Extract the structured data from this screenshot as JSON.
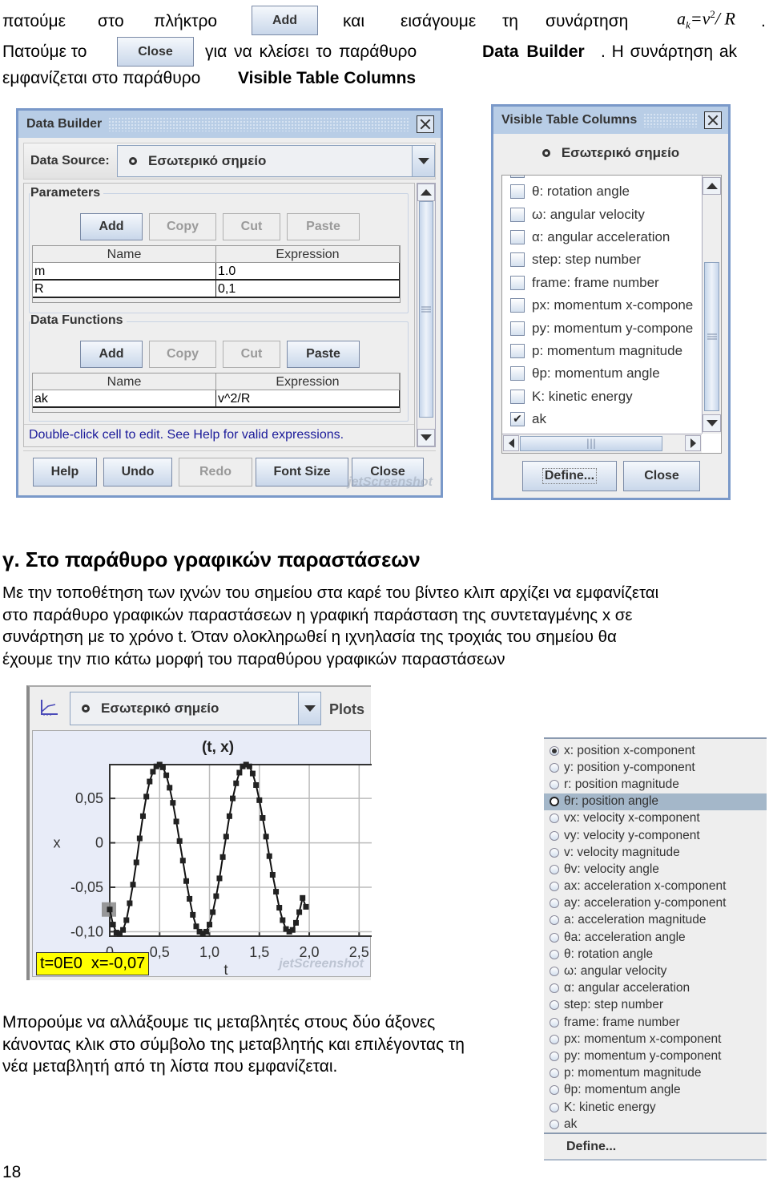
{
  "intro": {
    "line1_words": [
      "πατούμε",
      "στο",
      "πλήκτρο",
      "και",
      "εισάγουμε",
      "τη",
      "συνάρτηση"
    ],
    "inline_add_button": "Add",
    "formula": {
      "a": "a",
      "sub": "k",
      "eq": "=v",
      "sup": "2",
      "rest": "/ R",
      "end": "."
    },
    "line2_prefix": "Πατούμε το",
    "inline_close_button": "Close",
    "line2_mid": "για να κλείσει το παράθυρο",
    "line2_bold": "Data Builder",
    "line2_suffix": ". Η συνάρτηση ak",
    "line3_prefix": "εμφανίζεται στο παράθυρο",
    "line3_bold": "Visible Table Columns"
  },
  "data_builder": {
    "title": "Data Builder",
    "data_source_label": "Data Source:",
    "data_source_value": "Εσωτερικό σημείο",
    "parameters": {
      "label": "Parameters",
      "buttons": [
        {
          "label": "Add",
          "enabled": true
        },
        {
          "label": "Copy",
          "enabled": false
        },
        {
          "label": "Cut",
          "enabled": false
        },
        {
          "label": "Paste",
          "enabled": false
        }
      ],
      "columns": [
        "Name",
        "Expression"
      ],
      "rows": [
        [
          "m",
          "1.0"
        ],
        [
          "R",
          "0,1"
        ]
      ]
    },
    "functions": {
      "label": "Data Functions",
      "buttons": [
        {
          "label": "Add",
          "enabled": true
        },
        {
          "label": "Copy",
          "enabled": false
        },
        {
          "label": "Cut",
          "enabled": false
        },
        {
          "label": "Paste",
          "enabled": true
        }
      ],
      "columns": [
        "Name",
        "Expression"
      ],
      "rows": [
        [
          "ak",
          "v^2/R"
        ]
      ]
    },
    "hint": "Double-click cell to edit. See Help for valid expressions.",
    "footer_buttons": [
      {
        "label": "Help",
        "enabled": true
      },
      {
        "label": "Undo",
        "enabled": true
      },
      {
        "label": "Redo",
        "enabled": false
      },
      {
        "label": "Font Size",
        "enabled": true
      },
      {
        "label": "Close",
        "enabled": true
      }
    ],
    "watermark": "jetScreenshot"
  },
  "visible_columns": {
    "title": "Visible Table Columns",
    "source": "Εσωτερικό σημείο",
    "items": [
      {
        "label": "θ: rotation angle",
        "checked": false
      },
      {
        "label": "ω: angular velocity",
        "checked": false
      },
      {
        "label": "α: angular acceleration",
        "checked": false
      },
      {
        "label": "step: step number",
        "checked": false
      },
      {
        "label": "frame: frame number",
        "checked": false
      },
      {
        "label": "px: momentum x-compone",
        "checked": false
      },
      {
        "label": "py: momentum y-compone",
        "checked": false
      },
      {
        "label": "p: momentum magnitude",
        "checked": false
      },
      {
        "label": "θp: momentum angle",
        "checked": false
      },
      {
        "label": "K: kinetic energy",
        "checked": false
      },
      {
        "label": "ak",
        "checked": true
      }
    ],
    "check_mark": "✔",
    "define_button": "Define...",
    "close_button": "Close"
  },
  "section": {
    "heading": "γ. Στο παράθυρο γραφικών παραστάσεων",
    "paragraph_lines": [
      "Με την τοποθέτηση των ιχνών του σημείου στα καρέ του βίντεο κλιπ αρχίζει να εμφανίζεται",
      "στο παράθυρο γραφικών παραστάσεων η γραφική παράσταση της συντεταγμένης x σε",
      "συνάρτηση με το χρόνο t. Όταν ολοκληρωθεί η ιχνηλασία της τροχιάς του σημείου θα",
      "έχουμε την πιο κάτω μορφή του παραθύρου γραφικών παραστάσεων"
    ]
  },
  "plot_panel": {
    "source": "Εσωτερικό σημείο",
    "plots_label": "Plots",
    "readout": "t=0E0  x=-0,07",
    "watermark": "jetScreenshot"
  },
  "chart_data": {
    "type": "scatter",
    "title": "(t, x)",
    "xlabel": "t",
    "ylabel": "x",
    "xlim": [
      0,
      2.65
    ],
    "ylim": [
      -0.105,
      0.088
    ],
    "xticks": [
      0,
      0.5,
      1.0,
      1.5,
      2.0,
      2.5
    ],
    "xtick_labels": [
      "0",
      "0,5",
      "1,0",
      "1,5",
      "2,0",
      "2,5"
    ],
    "yticks": [
      -0.1,
      -0.05,
      0,
      0.05
    ],
    "ytick_labels": [
      "-0,10",
      "-0,05",
      "0",
      "0,05"
    ],
    "grid": true,
    "connected_line": true,
    "highlighted_point": [
      0,
      -0.075
    ],
    "series": [
      {
        "name": "x",
        "x": [
          0,
          0.033,
          0.067,
          0.1,
          0.133,
          0.167,
          0.2,
          0.233,
          0.267,
          0.3,
          0.333,
          0.367,
          0.4,
          0.433,
          0.467,
          0.5,
          0.533,
          0.567,
          0.6,
          0.633,
          0.667,
          0.7,
          0.733,
          0.767,
          0.8,
          0.833,
          0.867,
          0.9,
          0.933,
          0.967,
          1.0,
          1.033,
          1.067,
          1.1,
          1.133,
          1.167,
          1.2,
          1.233,
          1.267,
          1.3,
          1.333,
          1.367,
          1.4,
          1.433,
          1.467,
          1.5,
          1.533,
          1.567,
          1.6,
          1.633,
          1.667,
          1.7,
          1.733,
          1.767,
          1.8,
          1.833,
          1.867,
          1.9,
          1.933,
          1.967
        ],
        "y": [
          -0.075,
          -0.092,
          -0.101,
          -0.102,
          -0.098,
          -0.087,
          -0.068,
          -0.047,
          -0.022,
          0.005,
          0.03,
          0.052,
          0.069,
          0.08,
          0.086,
          0.088,
          0.085,
          0.076,
          0.062,
          0.045,
          0.024,
          0.002,
          -0.02,
          -0.043,
          -0.063,
          -0.081,
          -0.094,
          -0.1,
          -0.102,
          -0.1,
          -0.092,
          -0.078,
          -0.06,
          -0.04,
          -0.016,
          0.007,
          0.03,
          0.05,
          0.067,
          0.079,
          0.086,
          0.088,
          0.086,
          0.078,
          0.065,
          0.048,
          0.028,
          0.007,
          -0.015,
          -0.036,
          -0.055,
          -0.073,
          -0.087,
          -0.097,
          -0.1,
          -0.098,
          -0.09,
          -0.078,
          -0.062,
          -0.072
        ]
      }
    ]
  },
  "variable_menu": {
    "items": [
      {
        "label": "x: position x-component",
        "selected": true,
        "highlighted": false
      },
      {
        "label": "y: position y-component",
        "selected": false,
        "highlighted": false
      },
      {
        "label": "r: position magnitude",
        "selected": false,
        "highlighted": false
      },
      {
        "label": "θr: position angle",
        "selected": false,
        "highlighted": true
      },
      {
        "label": "vx: velocity x-component",
        "selected": false,
        "highlighted": false
      },
      {
        "label": "vy: velocity y-component",
        "selected": false,
        "highlighted": false
      },
      {
        "label": "v: velocity magnitude",
        "selected": false,
        "highlighted": false
      },
      {
        "label": "θv: velocity angle",
        "selected": false,
        "highlighted": false
      },
      {
        "label": "ax: acceleration x-component",
        "selected": false,
        "highlighted": false
      },
      {
        "label": "ay: acceleration y-component",
        "selected": false,
        "highlighted": false
      },
      {
        "label": "a: acceleration magnitude",
        "selected": false,
        "highlighted": false
      },
      {
        "label": "θa: acceleration angle",
        "selected": false,
        "highlighted": false
      },
      {
        "label": "θ: rotation angle",
        "selected": false,
        "highlighted": false
      },
      {
        "label": "ω: angular velocity",
        "selected": false,
        "highlighted": false
      },
      {
        "label": "α: angular acceleration",
        "selected": false,
        "highlighted": false
      },
      {
        "label": "step: step number",
        "selected": false,
        "highlighted": false
      },
      {
        "label": "frame: frame number",
        "selected": false,
        "highlighted": false
      },
      {
        "label": "px: momentum x-component",
        "selected": false,
        "highlighted": false
      },
      {
        "label": "py: momentum y-component",
        "selected": false,
        "highlighted": false
      },
      {
        "label": "p: momentum magnitude",
        "selected": false,
        "highlighted": false
      },
      {
        "label": "θp: momentum angle",
        "selected": false,
        "highlighted": false
      },
      {
        "label": "K: kinetic energy",
        "selected": false,
        "highlighted": false
      },
      {
        "label": "ak",
        "selected": false,
        "highlighted": false
      }
    ],
    "define_label": "Define..."
  },
  "closing_paragraph": [
    "Μπορούμε να αλλάξουμε τις μεταβλητές στους δύο άξονες",
    "κάνοντας κλικ στο σύμβολο της μεταβλητής και επιλέγοντας τη",
    "νέα μεταβλητή από τη λίστα που εμφανίζεται."
  ],
  "page_number": "18"
}
